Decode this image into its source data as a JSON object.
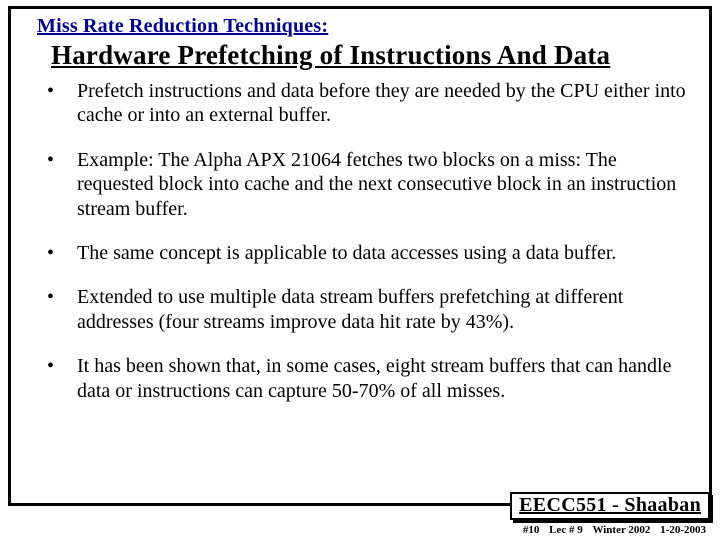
{
  "heading": "Miss Rate Reduction Techniques:",
  "subtitle": "Hardware Prefetching of Instructions And Data",
  "bullets": [
    "Prefetch instructions and data before they are needed by the CPU either into cache or into an external buffer.",
    "Example:  The Alpha APX 21064 fetches two blocks on a miss: The requested block into cache and the next consecutive block in an instruction stream buffer.",
    "The same concept is applicable to data accesses using a data buffer.",
    "Extended to use multiple data stream buffers prefetching at different addresses (four streams improve data hit rate by 43%).",
    "It has been shown that, in some cases, eight stream buffers that can handle data or instructions can capture 50-70% of all misses."
  ],
  "footer": {
    "course": "EECC551 - Shaaban",
    "slide_no": "#10",
    "lecture": "Lec # 9",
    "term": "Winter 2002",
    "date": "1-20-2003"
  }
}
